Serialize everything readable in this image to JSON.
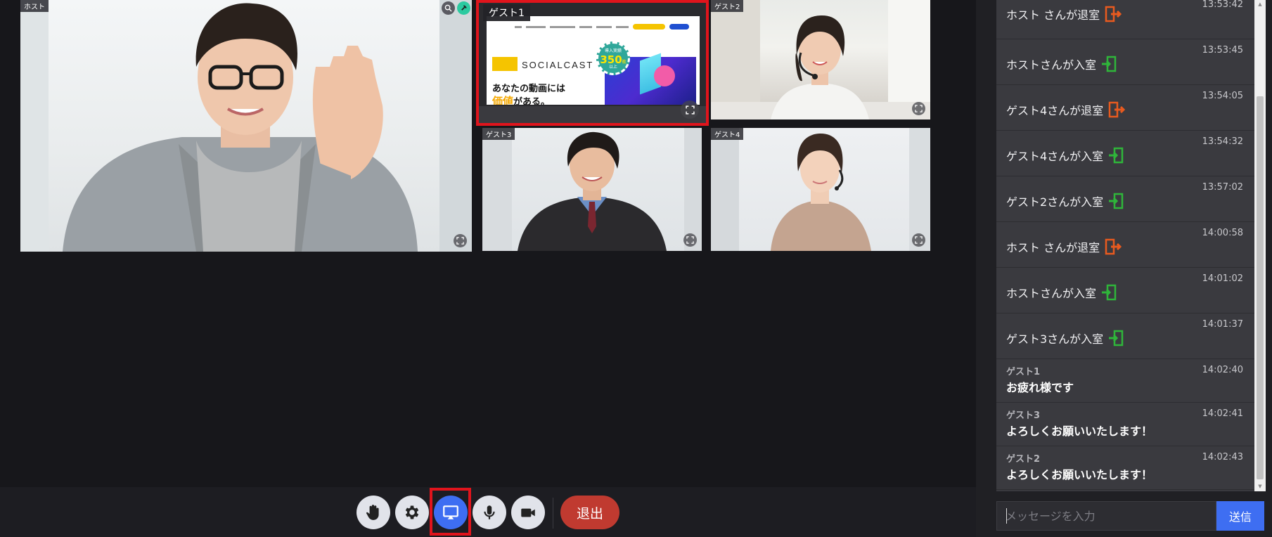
{
  "tiles": {
    "host": {
      "label": "ホスト"
    },
    "guest1": {
      "label": "ゲスト1"
    },
    "guest2": {
      "label": "ゲスト2"
    },
    "guest3": {
      "label": "ゲスト3"
    },
    "guest4": {
      "label": "ゲスト4"
    }
  },
  "shared_screen": {
    "brand": "SOCIALCAST",
    "copy_line1": "あなたの動画には",
    "copy_line2_highlight": "価値",
    "copy_line2_rest": "がある。",
    "badge_top": "導入実績",
    "badge_number": "350",
    "badge_suffix": "社",
    "badge_bottom": "以上"
  },
  "toolbar": {
    "exit_label": "退出",
    "icons": [
      "hand-icon",
      "gear-icon",
      "screen-share-icon",
      "microphone-icon",
      "video-camera-icon"
    ],
    "share_color": "#3e6ef2",
    "exit_color": "#c03a30"
  },
  "chat": {
    "messages": [
      {
        "type": "system",
        "text": "ホスト さんが退室",
        "event": "leave",
        "time": "13:53:42"
      },
      {
        "type": "system",
        "text": "ホストさんが入室",
        "event": "enter",
        "time": "13:53:45"
      },
      {
        "type": "system",
        "text": "ゲスト4さんが退室",
        "event": "leave",
        "time": "13:54:05"
      },
      {
        "type": "system",
        "text": "ゲスト4さんが入室",
        "event": "enter",
        "time": "13:54:32"
      },
      {
        "type": "system",
        "text": "ゲスト2さんが入室",
        "event": "enter",
        "time": "13:57:02"
      },
      {
        "type": "system",
        "text": "ホスト さんが退室",
        "event": "leave",
        "time": "14:00:58"
      },
      {
        "type": "system",
        "text": "ホストさんが入室",
        "event": "enter",
        "time": "14:01:02"
      },
      {
        "type": "system",
        "text": "ゲスト3さんが入室",
        "event": "enter",
        "time": "14:01:37"
      },
      {
        "type": "user",
        "name": "ゲスト1",
        "text": "お疲れ様です",
        "time": "14:02:40"
      },
      {
        "type": "user",
        "name": "ゲスト3",
        "text": "よろしくお願いいたします！",
        "time": "14:02:41"
      },
      {
        "type": "user",
        "name": "ゲスト2",
        "text": "よろしくお願いいたします！",
        "time": "14:02:43"
      }
    ],
    "input_placeholder": "メッセージを入力",
    "send_label": "送信",
    "enter_color": "#2fb53a",
    "leave_color": "#e85a1f"
  }
}
